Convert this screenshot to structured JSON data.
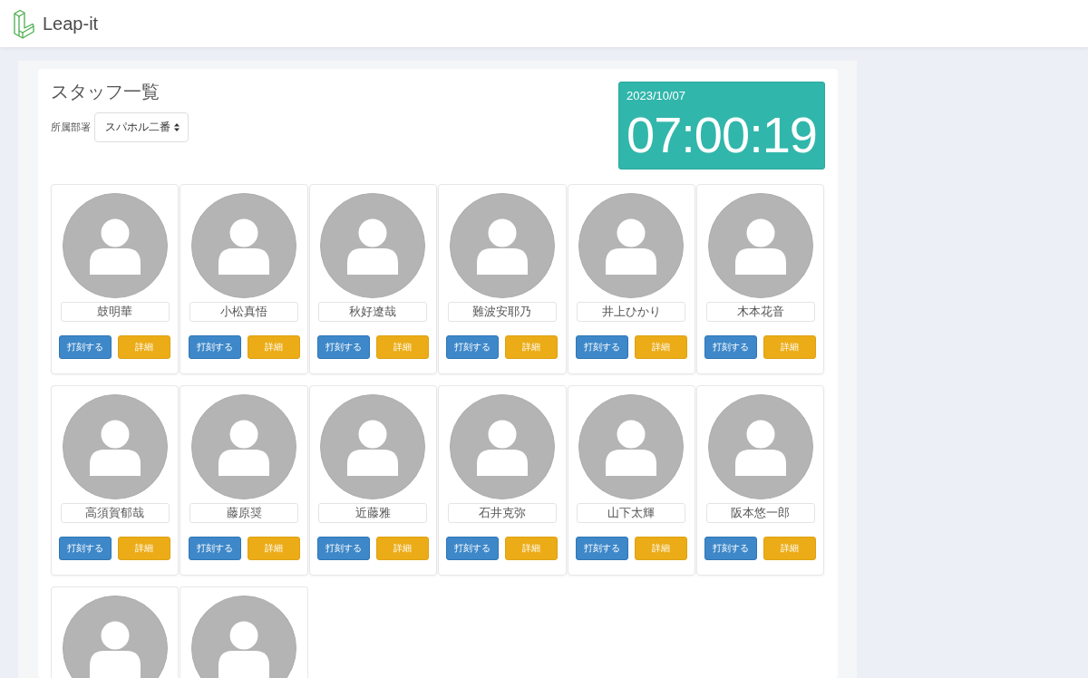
{
  "header": {
    "app_name": "Leap-it"
  },
  "page": {
    "title": "スタッフ一覧",
    "department": {
      "label": "所属部署",
      "value": "スパホル二番"
    },
    "clock": {
      "date": "2023/10/07",
      "time": "07:00:19"
    },
    "staff": [
      {
        "kind": "full",
        "name": "鼓明華",
        "buttons": [
          {
            "label": "打刻する",
            "kind": "punch"
          },
          {
            "label": "詳細",
            "kind": "detail"
          }
        ]
      },
      {
        "kind": "full",
        "name": "小松真悟",
        "buttons": [
          {
            "label": "打刻する",
            "kind": "punch"
          },
          {
            "label": "詳細",
            "kind": "detail"
          }
        ]
      },
      {
        "kind": "full",
        "name": "秋好遼哉",
        "buttons": [
          {
            "label": "打刻する",
            "kind": "punch"
          },
          {
            "label": "詳細",
            "kind": "detail"
          }
        ]
      },
      {
        "kind": "full",
        "name": "難波安耶乃",
        "buttons": [
          {
            "label": "打刻する",
            "kind": "punch"
          },
          {
            "label": "詳細",
            "kind": "detail"
          }
        ]
      },
      {
        "kind": "full",
        "name": "井上ひかり",
        "buttons": [
          {
            "label": "打刻する",
            "kind": "punch"
          },
          {
            "label": "詳細",
            "kind": "detail"
          }
        ]
      },
      {
        "kind": "full",
        "name": "木本花音",
        "buttons": [
          {
            "label": "打刻する",
            "kind": "punch"
          },
          {
            "label": "詳細",
            "kind": "detail"
          }
        ]
      },
      {
        "kind": "full",
        "name": "高須賀郁哉",
        "buttons": [
          {
            "label": "打刻する",
            "kind": "punch"
          },
          {
            "label": "詳細",
            "kind": "detail"
          }
        ]
      },
      {
        "kind": "full",
        "name": "藤原奨",
        "buttons": [
          {
            "label": "打刻する",
            "kind": "punch"
          },
          {
            "label": "詳細",
            "kind": "detail"
          }
        ]
      },
      {
        "kind": "full",
        "name": "近藤雅",
        "buttons": [
          {
            "label": "打刻する",
            "kind": "punch"
          },
          {
            "label": "詳細",
            "kind": "detail"
          }
        ]
      },
      {
        "kind": "full",
        "name": "石井克弥",
        "buttons": [
          {
            "label": "打刻する",
            "kind": "punch"
          },
          {
            "label": "詳細",
            "kind": "detail"
          }
        ]
      },
      {
        "kind": "full",
        "name": "山下太輝",
        "buttons": [
          {
            "label": "打刻する",
            "kind": "punch"
          },
          {
            "label": "詳細",
            "kind": "detail"
          }
        ]
      },
      {
        "kind": "full",
        "name": "阪本悠一郎",
        "buttons": [
          {
            "label": "打刻する",
            "kind": "punch"
          },
          {
            "label": "詳細",
            "kind": "detail"
          }
        ]
      },
      {
        "kind": "partial"
      },
      {
        "kind": "partial"
      }
    ]
  }
}
